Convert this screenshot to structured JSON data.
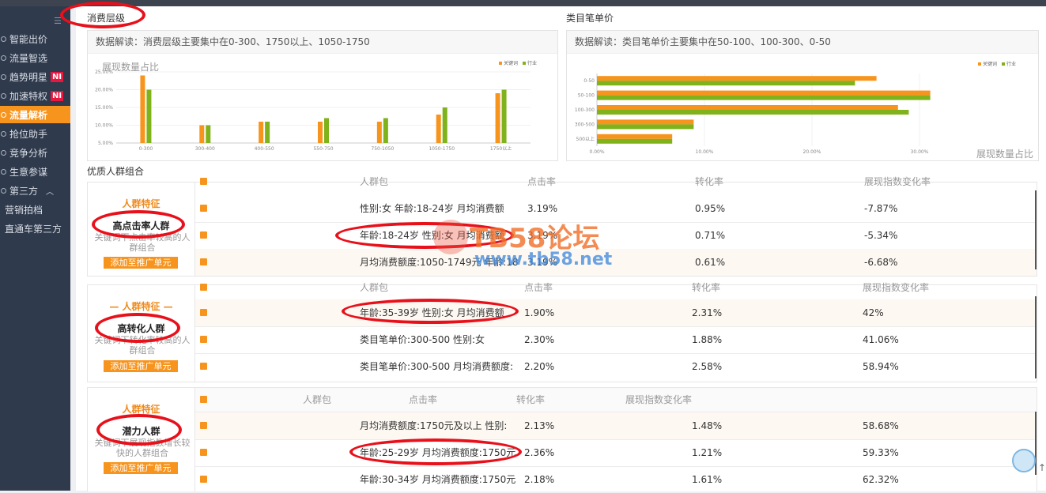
{
  "sidebar": {
    "items": [
      {
        "label": "智能出价"
      },
      {
        "label": "流量智选"
      },
      {
        "label": "趋势明星",
        "badge": "NI"
      },
      {
        "label": "加速特权",
        "badge": "NI"
      },
      {
        "label": "流量解析",
        "active": true
      },
      {
        "label": "抢位助手"
      },
      {
        "label": "竞争分析"
      },
      {
        "label": "生意参谋"
      },
      {
        "label": "第三方"
      }
    ],
    "sub_items": [
      {
        "label": "营销拍档"
      },
      {
        "label": "直通车第三方"
      }
    ]
  },
  "consume": {
    "section_title": "消费层级",
    "note": "数据解读：消费层级主要集中在0-300、1750以上、1050-1750",
    "chart_caption": "展现数量占比"
  },
  "unit_price": {
    "section_title": "类目笔单价",
    "note": "数据解读：类目笔单价主要集中在50-100、100-300、0-50",
    "chart_caption": "展现数量占比"
  },
  "chart_data": [
    {
      "type": "bar",
      "categories": [
        "0-300",
        "300-400",
        "400-550",
        "550-750",
        "750-1050",
        "1050-1750",
        "1750以上"
      ],
      "series": [
        {
          "name": "关键词",
          "color": "#f7941d",
          "values": [
            24.0,
            10.0,
            11.0,
            11.0,
            11.0,
            13.0,
            19.0
          ]
        },
        {
          "name": "行业",
          "color": "#7fb21b",
          "values": [
            20.0,
            10.0,
            11.0,
            12.0,
            12.0,
            15.0,
            20.0
          ]
        }
      ],
      "yticks": [
        "5.00%",
        "10.00%",
        "15.00%",
        "20.00%",
        "25.00%"
      ],
      "ylim": [
        5,
        25
      ],
      "legend_position": "top-right"
    },
    {
      "type": "bar",
      "orientation": "horizontal",
      "categories": [
        "0-50",
        "50-100",
        "100-300",
        "300-500",
        "500以上"
      ],
      "series": [
        {
          "name": "关键词",
          "color": "#f7941d",
          "values": [
            13.0,
            15.5,
            14.0,
            4.5,
            3.5
          ]
        },
        {
          "name": "行业",
          "color": "#7fb21b",
          "values": [
            12.0,
            15.5,
            14.5,
            4.5,
            3.5
          ]
        }
      ],
      "xticks": [
        "0.00%",
        "10.00%",
        "20.00%",
        "30.00%"
      ],
      "xlim": [
        0,
        20
      ],
      "legend_position": "top-right"
    }
  ],
  "quality": {
    "section_title": "优质人群组合",
    "headers": {
      "pkg": "人群包",
      "ctr": "点击率",
      "cvr": "转化率",
      "change": "展现指数变化率"
    },
    "groups": [
      {
        "feature": "人群特征",
        "name": "高点击率人群",
        "desc": "关键词下点击率较高的人群组合",
        "button": "添加至推广单元",
        "rows": [
          {
            "pkg": "性别:女  年龄:18-24岁  月均消费额",
            "ctr": "3.19%",
            "cvr": "0.95%",
            "change": "-7.87%"
          },
          {
            "pkg": "年龄:18-24岁  性别:女  月均消费额",
            "ctr": "3.19%",
            "cvr": "0.71%",
            "change": "-5.34%"
          },
          {
            "pkg": "月均消费额度:1050-1749元  年龄:18",
            "ctr": "3.19%",
            "cvr": "0.61%",
            "change": "-6.68%"
          }
        ]
      },
      {
        "feature": "— 人群特征 —",
        "name": "高转化人群",
        "desc": "关键词下转化率较高的人群组合",
        "button": "添加至推广单元",
        "rows": [
          {
            "pkg": "年龄:35-39岁  性别:女  月均消费额",
            "ctr": "1.90%",
            "cvr": "2.31%",
            "change": "42%"
          },
          {
            "pkg": "类目笔单价:300-500  性别:女",
            "ctr": "2.30%",
            "cvr": "1.88%",
            "change": "41.06%"
          },
          {
            "pkg": "类目笔单价:300-500  月均消费额度:",
            "ctr": "2.20%",
            "cvr": "2.58%",
            "change": "58.94%"
          }
        ]
      },
      {
        "feature": "人群特征",
        "name": "潜力人群",
        "desc": "关键词下展现指数增长较快的人群组合",
        "button": "添加至推广单元",
        "rows": [
          {
            "pkg": "月均消费额度:1750元及以上  性别:",
            "ctr": "2.13%",
            "cvr": "1.48%",
            "change": "58.68%"
          },
          {
            "pkg": "年龄:25-29岁  月均消费额度:1750元",
            "ctr": "2.36%",
            "cvr": "1.21%",
            "change": "59.33%"
          },
          {
            "pkg": "年龄:30-34岁  月均消费额度:1750元",
            "ctr": "2.18%",
            "cvr": "1.61%",
            "change": "62.32%"
          }
        ]
      }
    ]
  },
  "watermark": {
    "line1": "TB58论坛",
    "line2": "www.tb58.net"
  }
}
